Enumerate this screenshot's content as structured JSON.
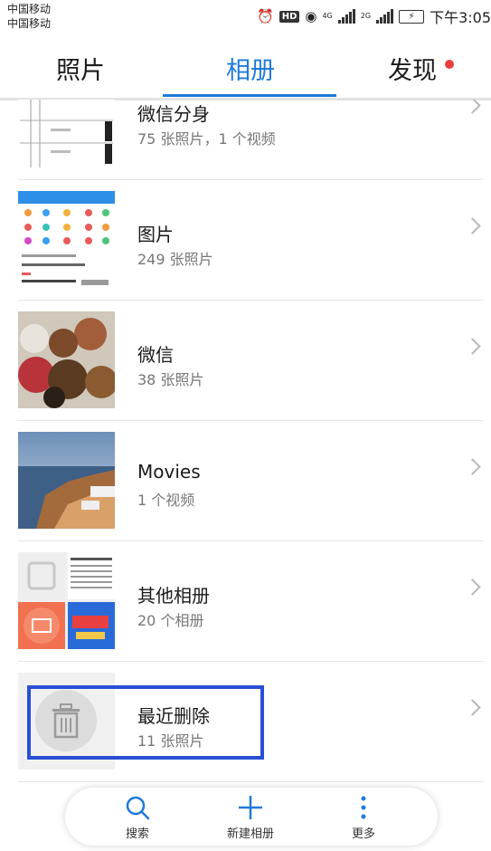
{
  "status_bar": {
    "carrier1": "中国移动",
    "carrier2": "中国移动",
    "net1": "4G",
    "net2": "2G",
    "hd": "HD",
    "time": "下午3:05",
    "icons": [
      "alarm-icon",
      "hd-icon",
      "eye-icon",
      "signal-icon",
      "battery-charging-icon"
    ]
  },
  "tabs": {
    "photos": "照片",
    "albums": "相册",
    "discover": "发现",
    "active": "albums",
    "accent_color": "#1f7ad8",
    "badge_color": "#e84040"
  },
  "albums": [
    {
      "name": "微信分身",
      "count": "75 张照片，1 个视频",
      "thumb": "screenshot-table"
    },
    {
      "name": "图片",
      "count": "249 张照片",
      "thumb": "app-screenshot"
    },
    {
      "name": "微信",
      "count": "38 张照片",
      "thumb": "fruit-photo"
    },
    {
      "name": "Movies",
      "count": "1 个视频",
      "thumb": "seaside-cliff-photo"
    },
    {
      "name": "其他相册",
      "count": "20 个相册",
      "thumb": "album-collage"
    },
    {
      "name": "最近删除",
      "count": "11 张照片",
      "thumb": "trash-icon"
    }
  ],
  "bottom_nav": {
    "search": "搜索",
    "new_album": "新建相册",
    "more": "更多"
  },
  "highlight_color": "#2a4fd6"
}
